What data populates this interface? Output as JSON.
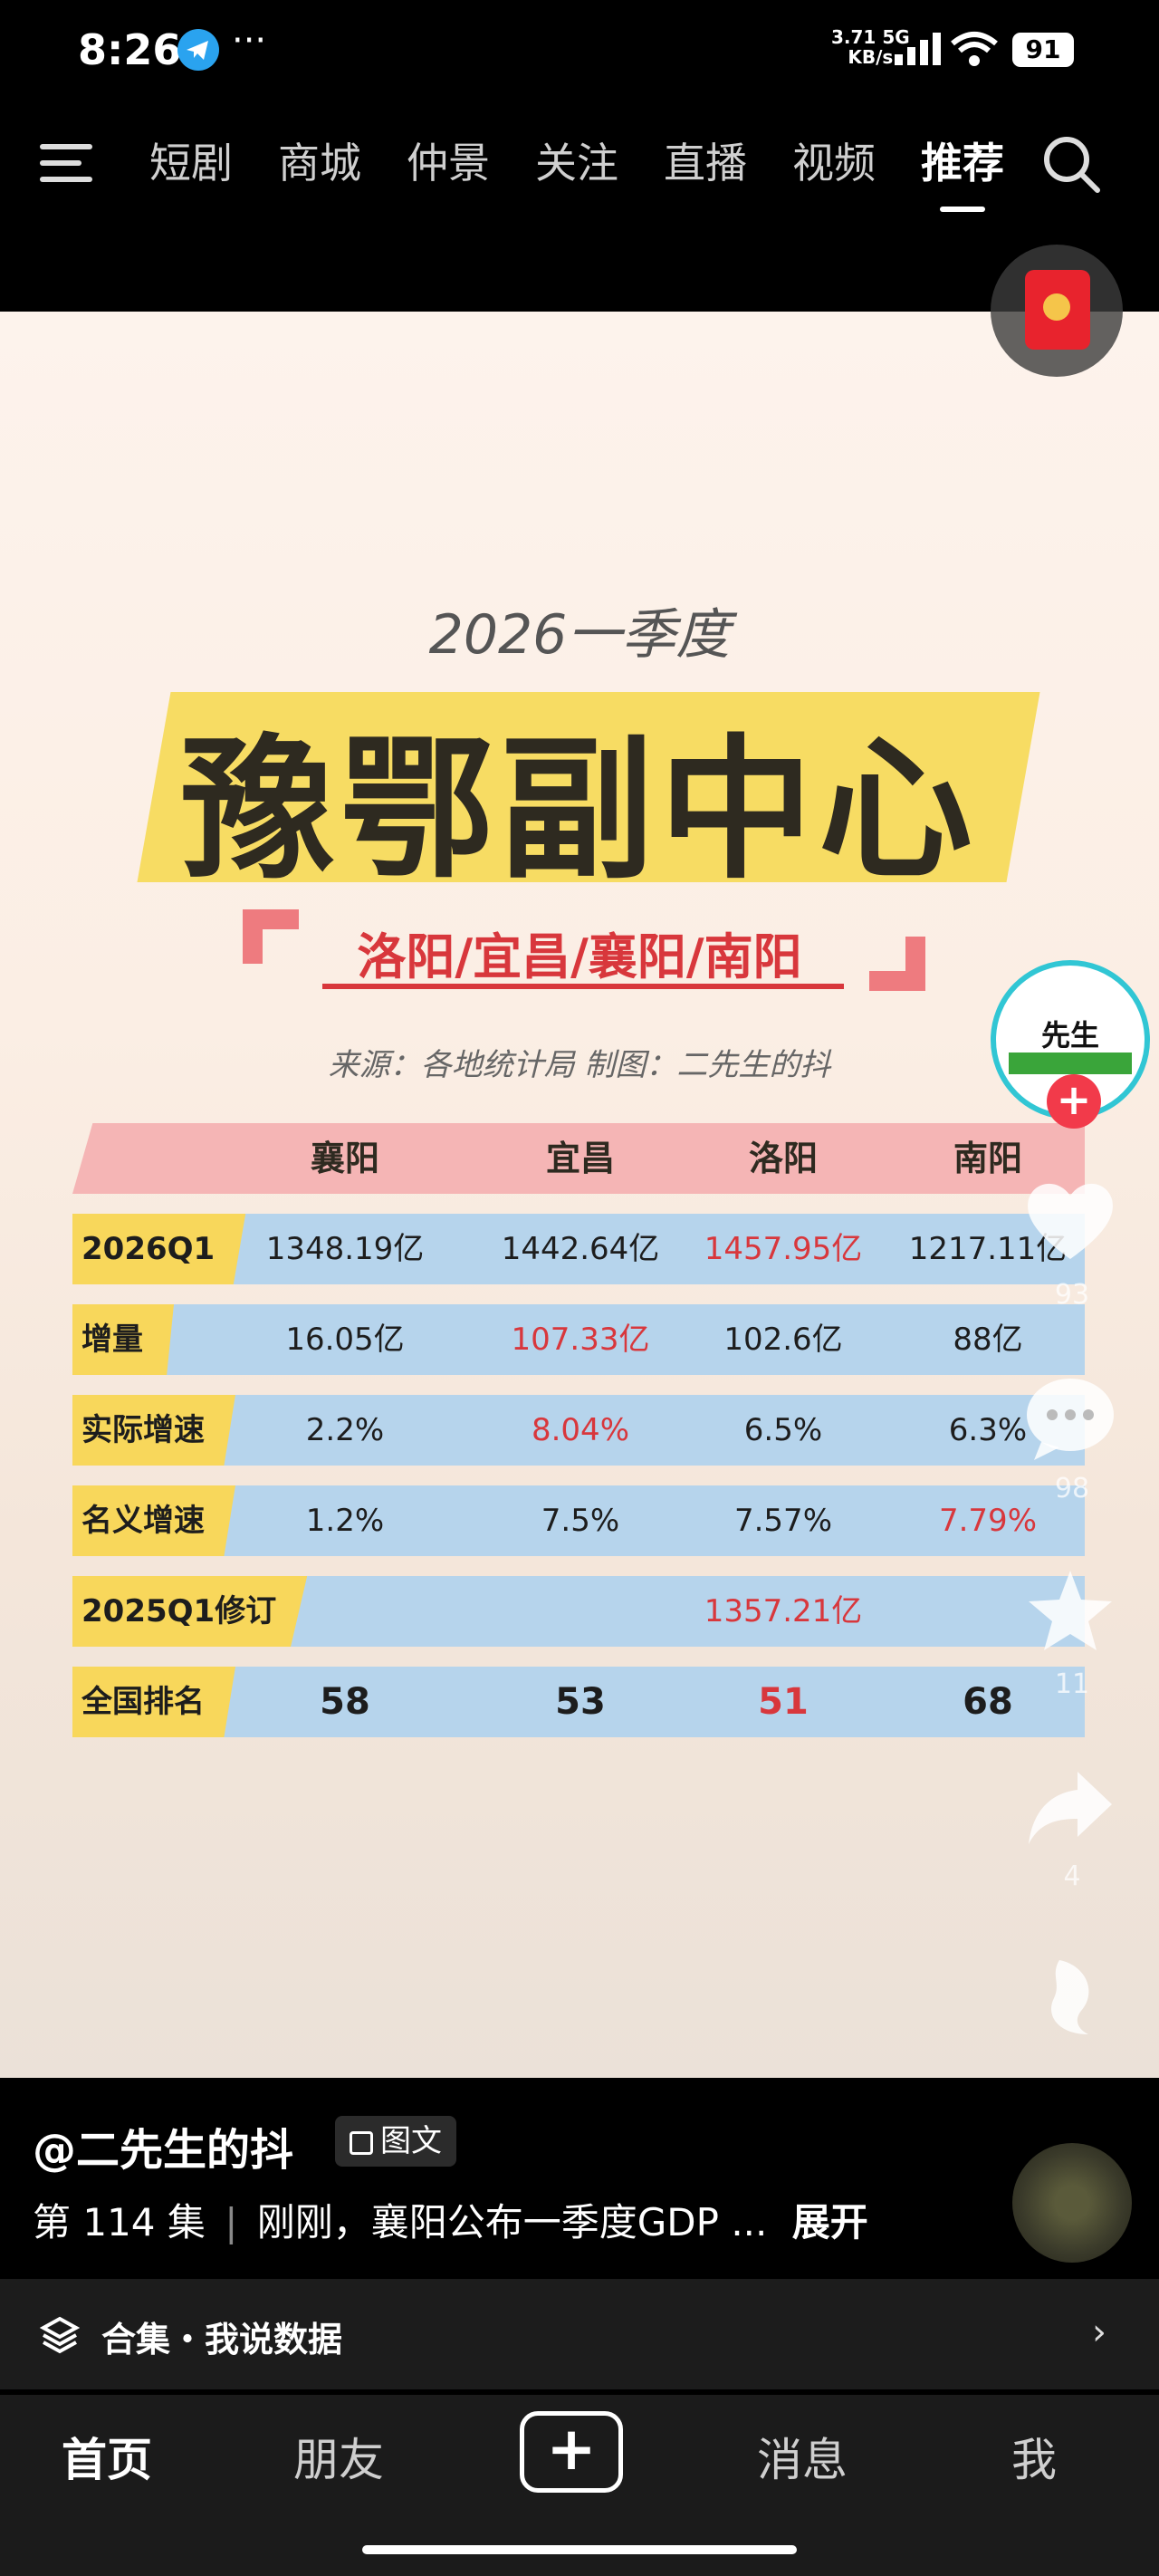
{
  "status_bar": {
    "time": "8:26",
    "more": "···",
    "net_speed": "3.71",
    "net_unit": "KB/s",
    "network": "5G",
    "battery": "91"
  },
  "top_nav": {
    "tabs": [
      "短剧",
      "商城",
      "仲景",
      "关注",
      "直播",
      "视频",
      "推荐"
    ],
    "active_tab": "推荐"
  },
  "post": {
    "period": "2026一季度",
    "title": "豫鄂副中心",
    "cities": "洛阳/宜昌/襄阳/南阳",
    "source": "来源：各地统计局 制图：二先生的抖",
    "table": {
      "headers": [
        "襄阳",
        "宜昌",
        "洛阳",
        "南阳"
      ],
      "rows": [
        {
          "label": "2026Q1",
          "cells": [
            "1348.19亿",
            "1442.64亿",
            "1457.95亿",
            "1217.11亿"
          ],
          "red": [
            2
          ]
        },
        {
          "label": "增量",
          "cells": [
            "16.05亿",
            "107.33亿",
            "102.6亿",
            "88亿"
          ],
          "red": [
            1
          ]
        },
        {
          "label": "实际增速",
          "cells": [
            "2.2%",
            "8.04%",
            "6.5%",
            "6.3%"
          ],
          "red": [
            1
          ]
        },
        {
          "label": "名义增速",
          "cells": [
            "1.2%",
            "7.5%",
            "7.57%",
            "7.79%"
          ],
          "red": [
            3
          ]
        },
        {
          "label": "2025Q1修订",
          "cells": [
            "",
            "",
            "1357.21亿",
            ""
          ],
          "red": [
            2
          ]
        },
        {
          "label": "全国排名",
          "cells": [
            "58",
            "53",
            "51",
            "68"
          ],
          "red": [
            2
          ]
        }
      ]
    }
  },
  "side": {
    "avatar_label": "先生",
    "likes": "93",
    "comments": "98",
    "favorites": "11",
    "shares": "4",
    "follow_symbol": "+"
  },
  "info": {
    "author": "@二先生的抖",
    "badge": "图文",
    "episode": "第 114 集",
    "description": "刚刚，襄阳公布一季度GDP ...",
    "expand": "展开",
    "collection": "合集・我说数据"
  },
  "bottom_nav": {
    "home": "首页",
    "friends": "朋友",
    "add": "+",
    "messages": "消息",
    "me": "我"
  }
}
